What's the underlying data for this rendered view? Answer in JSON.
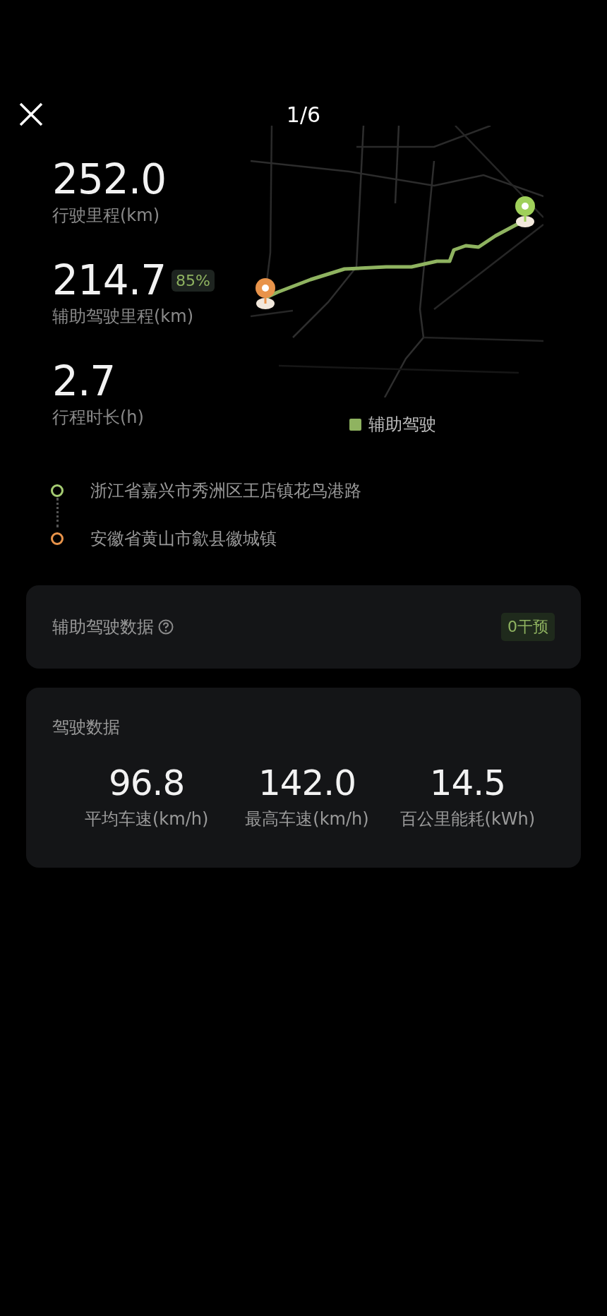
{
  "header": {
    "page": "1/6"
  },
  "stats": [
    {
      "value": "252.0",
      "label": "行驶里程(km)"
    },
    {
      "value": "214.7",
      "label": "辅助驾驶里程(km)",
      "badge": "85%"
    },
    {
      "value": "2.7",
      "label": "行程时长(h)"
    }
  ],
  "map": {
    "legend": "辅助驾驶"
  },
  "route": [
    {
      "place": "浙江省嘉兴市秀洲区王店镇花鸟港路",
      "color": "#a5cc72"
    },
    {
      "place": "安徽省黄山市歙县徽城镇",
      "color": "#e8934a"
    }
  ],
  "assist_card": {
    "title": "辅助驾驶数据",
    "badge": "0干预"
  },
  "driving_card": {
    "title": "驾驶数据",
    "metrics": [
      {
        "value": "96.8",
        "label": "平均车速(km/h)"
      },
      {
        "value": "142.0",
        "label": "最高车速(km/h)"
      },
      {
        "value": "14.5",
        "label": "百公里能耗(kWh)"
      }
    ]
  }
}
